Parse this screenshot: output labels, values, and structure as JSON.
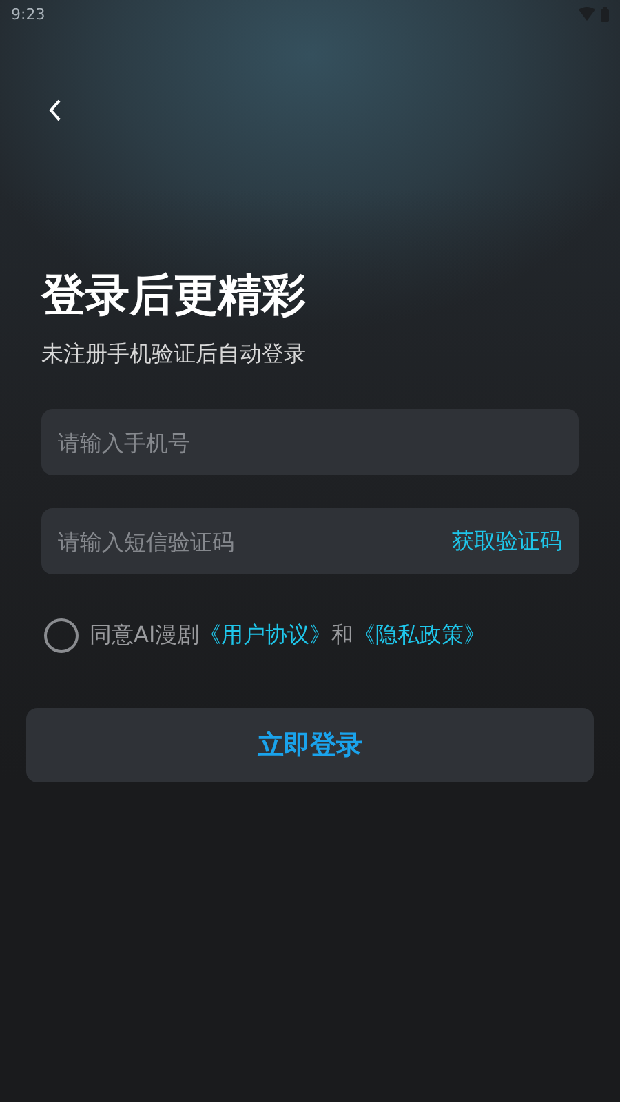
{
  "status_bar": {
    "time": "9:23"
  },
  "title": "登录后更精彩",
  "subtitle": "未注册手机验证后自动登录",
  "phone_field": {
    "placeholder": "请输入手机号"
  },
  "code_field": {
    "placeholder": "请输入短信验证码",
    "action": "获取验证码"
  },
  "agreement": {
    "checked": false,
    "parts": [
      {
        "kind": "text",
        "text": "同意AI漫剧"
      },
      {
        "kind": "link",
        "text": "《用户协议》"
      },
      {
        "kind": "text",
        "text": "和"
      },
      {
        "kind": "link",
        "text": "《隐私政策》"
      }
    ]
  },
  "login_button": "立即登录"
}
